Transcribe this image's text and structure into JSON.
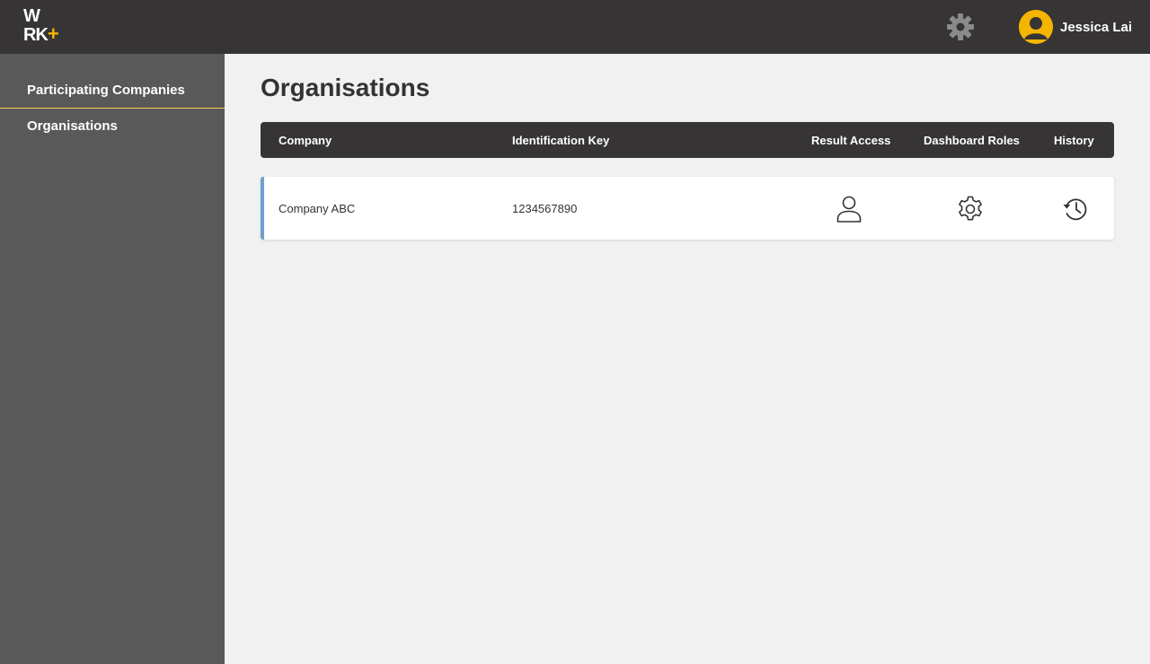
{
  "header": {
    "logo": {
      "line1": "W",
      "line2": "RK",
      "plus": "+"
    },
    "settings_icon": "gear-icon",
    "user": {
      "name": "Jessica Lai",
      "avatar_icon": "user-avatar-icon",
      "avatar_color": "#f4b400"
    }
  },
  "sidebar": {
    "items": [
      {
        "label": "Participating Companies"
      },
      {
        "label": "Organisations"
      }
    ],
    "active_indicator_color": "#f4c842"
  },
  "main": {
    "title": "Organisations",
    "table": {
      "columns": [
        "Company",
        "Identification Key",
        "Result Access",
        "Dashboard Roles",
        "History"
      ],
      "rows": [
        {
          "company": "Company ABC",
          "identification_key": "1234567890",
          "result_access_icon": "user-icon",
          "dashboard_roles_icon": "gear-icon",
          "history_icon": "history-icon"
        }
      ],
      "row_accent_color": "#6da1cf"
    }
  }
}
